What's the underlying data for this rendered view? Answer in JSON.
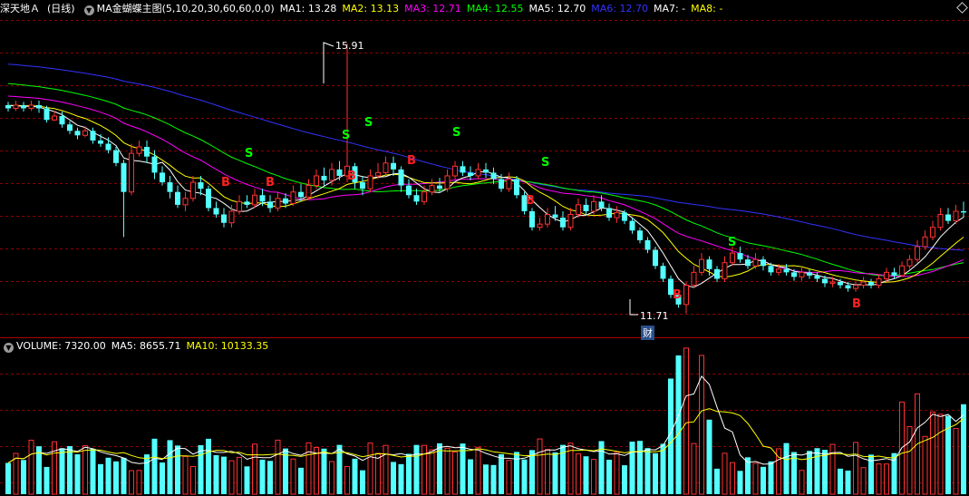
{
  "stock": {
    "name": "深天地Ａ",
    "period": "(日线)"
  },
  "indicator": {
    "name": "MA金蝴蝶主图(5,10,20,30,60,60,0,0)"
  },
  "ma_values": [
    {
      "label": "MA1: 13.28",
      "color": "#ffffff"
    },
    {
      "label": "MA2: 13.13",
      "color": "#ffff00"
    },
    {
      "label": "MA3: 12.71",
      "color": "#ff00ff"
    },
    {
      "label": "MA4: 12.55",
      "color": "#00ff00"
    },
    {
      "label": "MA5: 12.70",
      "color": "#ffffff"
    },
    {
      "label": "MA6: 12.70",
      "color": "#3333ff"
    },
    {
      "label": "MA7: -",
      "color": "#ffffff"
    },
    {
      "label": "MA8: -",
      "color": "#ffff00"
    }
  ],
  "volume_header": {
    "volume": "VOLUME: 7320.00",
    "ma5": "MA5: 8655.71",
    "ma10": "MA10: 10133.35"
  },
  "price_annotations": {
    "high": "15.91",
    "low": "11.71",
    "finance_marker": "财"
  },
  "signals": {
    "buy_label": "B",
    "sell_label": "S",
    "buy_color": "#ff2020",
    "sell_color": "#00ff00"
  },
  "colors": {
    "up": "#ff3232",
    "down": "#54ffff",
    "grid": "#8b0000",
    "background": "#000000",
    "ma5_line": "#ffffff",
    "ma10_line": "#ffff00",
    "ma20_line": "#ff00ff",
    "ma30_line": "#00ff00",
    "ma60_line": "#3333ff"
  },
  "chart_data": {
    "type": "candlestick",
    "price_range": [
      11.4,
      16.3
    ],
    "high": 15.91,
    "low": 11.71,
    "candles_ohlc": [
      [
        14.95,
        14.9,
        15.0,
        14.85
      ],
      [
        14.9,
        14.95,
        15.02,
        14.86
      ],
      [
        14.95,
        14.9,
        15.0,
        14.85
      ],
      [
        14.9,
        14.95,
        15.02,
        14.86
      ],
      [
        14.95,
        14.9,
        15.02,
        14.83
      ],
      [
        14.9,
        14.72,
        14.94,
        14.68
      ],
      [
        14.72,
        14.78,
        14.86,
        14.7
      ],
      [
        14.78,
        14.65,
        14.85,
        14.6
      ],
      [
        14.65,
        14.55,
        14.7,
        14.5
      ],
      [
        14.55,
        14.48,
        14.6,
        14.42
      ],
      [
        14.48,
        14.55,
        14.62,
        14.45
      ],
      [
        14.55,
        14.4,
        14.6,
        14.35
      ],
      [
        14.4,
        14.35,
        14.5,
        14.3
      ],
      [
        14.35,
        14.25,
        14.45,
        14.2
      ],
      [
        14.25,
        14.05,
        14.3,
        14.0
      ],
      [
        14.05,
        13.6,
        14.1,
        12.9
      ],
      [
        13.6,
        14.2,
        14.35,
        13.55
      ],
      [
        14.2,
        14.3,
        14.4,
        14.15
      ],
      [
        14.3,
        14.15,
        14.4,
        14.05
      ],
      [
        14.15,
        13.9,
        14.25,
        13.8
      ],
      [
        13.9,
        13.75,
        14.0,
        13.7
      ],
      [
        13.75,
        13.6,
        13.85,
        13.5
      ],
      [
        13.6,
        13.4,
        13.7,
        13.35
      ],
      [
        13.4,
        13.5,
        13.6,
        13.3
      ],
      [
        13.5,
        13.75,
        13.85,
        13.45
      ],
      [
        13.75,
        13.65,
        13.85,
        13.55
      ],
      [
        13.65,
        13.35,
        13.7,
        13.3
      ],
      [
        13.35,
        13.25,
        13.45,
        13.2
      ],
      [
        13.25,
        13.12,
        13.35,
        13.05
      ],
      [
        13.12,
        13.3,
        13.4,
        13.05
      ],
      [
        13.3,
        13.45,
        13.55,
        13.25
      ],
      [
        13.45,
        13.4,
        13.55,
        13.35
      ],
      [
        13.4,
        13.55,
        13.65,
        13.35
      ],
      [
        13.55,
        13.45,
        13.65,
        13.38
      ],
      [
        13.45,
        13.35,
        13.55,
        13.28
      ],
      [
        13.35,
        13.5,
        13.6,
        13.3
      ],
      [
        13.5,
        13.42,
        13.58,
        13.35
      ],
      [
        13.42,
        13.6,
        13.7,
        13.38
      ],
      [
        13.6,
        13.52,
        13.72,
        13.45
      ],
      [
        13.52,
        13.7,
        13.8,
        13.48
      ],
      [
        13.7,
        13.85,
        13.95,
        13.65
      ],
      [
        13.85,
        13.78,
        13.98,
        13.7
      ],
      [
        13.78,
        13.95,
        14.05,
        13.7
      ],
      [
        13.95,
        13.85,
        14.08,
        13.78
      ],
      [
        13.85,
        14.0,
        15.91,
        13.75
      ],
      [
        14.0,
        13.75,
        14.05,
        13.65
      ],
      [
        13.75,
        13.65,
        13.85,
        13.55
      ],
      [
        13.65,
        13.85,
        13.95,
        13.6
      ],
      [
        13.85,
        13.9,
        14.05,
        13.8
      ],
      [
        13.9,
        14.05,
        14.15,
        13.85
      ],
      [
        14.05,
        13.95,
        14.15,
        13.85
      ],
      [
        13.95,
        13.7,
        14.0,
        13.6
      ],
      [
        13.7,
        13.55,
        13.8,
        13.5
      ],
      [
        13.55,
        13.45,
        13.65,
        13.4
      ],
      [
        13.45,
        13.6,
        13.7,
        13.4
      ],
      [
        13.6,
        13.7,
        13.8,
        13.55
      ],
      [
        13.7,
        13.65,
        13.82,
        13.6
      ],
      [
        13.65,
        13.85,
        13.95,
        13.6
      ],
      [
        13.85,
        14.0,
        14.08,
        13.8
      ],
      [
        14.0,
        13.9,
        14.08,
        13.85
      ],
      [
        13.9,
        13.85,
        14.0,
        13.78
      ],
      [
        13.85,
        13.95,
        14.05,
        13.8
      ],
      [
        13.95,
        13.9,
        14.05,
        13.82
      ],
      [
        13.9,
        13.8,
        13.98,
        13.72
      ],
      [
        13.8,
        13.65,
        13.88,
        13.6
      ],
      [
        13.65,
        13.8,
        13.9,
        13.6
      ],
      [
        13.8,
        13.55,
        13.85,
        13.5
      ],
      [
        13.55,
        13.3,
        13.6,
        13.25
      ],
      [
        13.3,
        13.05,
        13.35,
        13.0
      ],
      [
        13.05,
        13.1,
        13.2,
        13.0
      ],
      [
        13.1,
        13.25,
        13.35,
        13.05
      ],
      [
        13.25,
        13.2,
        13.38,
        13.15
      ],
      [
        13.2,
        13.05,
        13.3,
        13.0
      ],
      [
        13.05,
        13.25,
        13.35,
        13.0
      ],
      [
        13.25,
        13.4,
        13.5,
        13.2
      ],
      [
        13.4,
        13.3,
        13.5,
        13.25
      ],
      [
        13.3,
        13.45,
        13.55,
        13.25
      ],
      [
        13.45,
        13.35,
        13.55,
        13.3
      ],
      [
        13.35,
        13.2,
        13.42,
        13.15
      ],
      [
        13.2,
        13.28,
        13.38,
        13.12
      ],
      [
        13.28,
        13.15,
        13.32,
        13.1
      ],
      [
        13.15,
        13.0,
        13.2,
        12.95
      ],
      [
        13.0,
        12.85,
        13.05,
        12.8
      ],
      [
        12.85,
        12.7,
        12.9,
        12.65
      ],
      [
        12.7,
        12.45,
        12.75,
        12.4
      ],
      [
        12.45,
        12.25,
        12.5,
        12.2
      ],
      [
        12.25,
        12.0,
        12.3,
        11.95
      ],
      [
        12.0,
        11.85,
        12.05,
        11.8
      ],
      [
        11.85,
        12.15,
        12.2,
        11.71
      ],
      [
        12.15,
        12.35,
        12.45,
        12.1
      ],
      [
        12.35,
        12.55,
        12.65,
        12.3
      ],
      [
        12.55,
        12.4,
        12.6,
        12.3
      ],
      [
        12.4,
        12.25,
        12.45,
        12.2
      ],
      [
        12.25,
        12.5,
        12.6,
        12.2
      ],
      [
        12.5,
        12.65,
        12.75,
        12.45
      ],
      [
        12.65,
        12.55,
        12.75,
        12.5
      ],
      [
        12.55,
        12.45,
        12.62,
        12.4
      ],
      [
        12.45,
        12.55,
        12.65,
        12.4
      ],
      [
        12.55,
        12.45,
        12.6,
        12.38
      ],
      [
        12.45,
        12.35,
        12.5,
        12.3
      ],
      [
        12.35,
        12.4,
        12.48,
        12.3
      ],
      [
        12.4,
        12.35,
        12.48,
        12.3
      ],
      [
        12.35,
        12.28,
        12.4,
        12.22
      ],
      [
        12.28,
        12.35,
        12.45,
        12.22
      ],
      [
        12.35,
        12.3,
        12.4,
        12.25
      ],
      [
        12.3,
        12.25,
        12.35,
        12.2
      ],
      [
        12.25,
        12.18,
        12.3,
        12.12
      ],
      [
        12.18,
        12.2,
        12.28,
        12.12
      ],
      [
        12.2,
        12.15,
        12.25,
        12.1
      ],
      [
        12.15,
        12.1,
        12.2,
        12.05
      ],
      [
        12.1,
        12.15,
        12.2,
        12.05
      ],
      [
        12.15,
        12.2,
        12.28,
        12.1
      ],
      [
        12.2,
        12.15,
        12.25,
        12.1
      ],
      [
        12.15,
        12.25,
        12.32,
        12.1
      ],
      [
        12.25,
        12.35,
        12.42,
        12.2
      ],
      [
        12.35,
        12.3,
        12.42,
        12.25
      ],
      [
        12.3,
        12.45,
        12.52,
        12.28
      ],
      [
        12.45,
        12.55,
        12.62,
        12.4
      ],
      [
        12.55,
        12.75,
        12.85,
        12.5
      ],
      [
        12.75,
        12.9,
        13.0,
        12.7
      ],
      [
        12.9,
        13.05,
        13.15,
        12.85
      ],
      [
        13.05,
        13.25,
        13.35,
        13.0
      ],
      [
        13.25,
        13.15,
        13.35,
        13.1
      ],
      [
        13.15,
        13.3,
        13.4,
        13.1
      ],
      [
        13.3,
        13.28,
        13.45,
        13.2
      ]
    ],
    "volume_range": [
      0,
      30000
    ]
  }
}
